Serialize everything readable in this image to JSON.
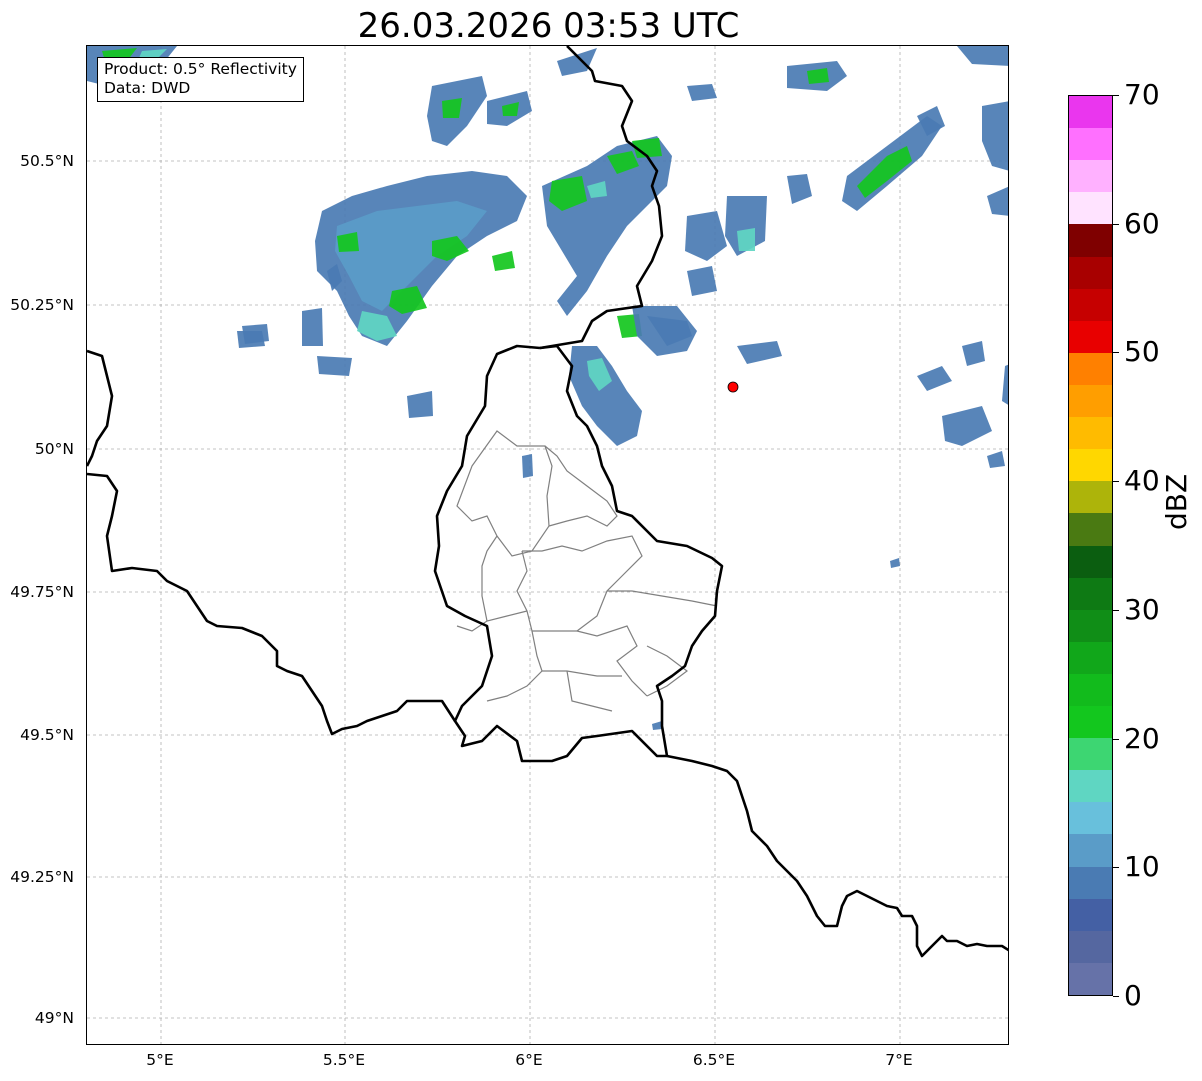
{
  "title": "26.03.2026 03:53 UTC",
  "info": {
    "product": "Product: 0.5° Reflectivity",
    "data_source": "Data: DWD"
  },
  "axes": {
    "lat_ticks": [
      "50.5°N",
      "50.25°N",
      "50°N",
      "49.75°N",
      "49.5°N",
      "49.25°N",
      "49°N"
    ],
    "lon_ticks": [
      "5°E",
      "5.5°E",
      "6°E",
      "6.5°E",
      "7°E"
    ]
  },
  "colorbar": {
    "label": "dBZ",
    "ticks": [
      "0",
      "10",
      "20",
      "30",
      "40",
      "50",
      "60",
      "70"
    ],
    "min": 0,
    "max": 70,
    "step": 2.5,
    "colors": [
      "#6672a8",
      "#5567a0",
      "#4460a4",
      "#4a7bb3",
      "#5a9cc8",
      "#68c0dc",
      "#5fd6c2",
      "#3dd672",
      "#13c71e",
      "#12bb1c",
      "#11a71a",
      "#108e17",
      "#0e7a14",
      "#0b5e10",
      "#4a7a12",
      "#adb40a",
      "#ffd700",
      "#ffbb00",
      "#ff9e00",
      "#ff8000",
      "#e80000",
      "#c60000",
      "#a80000",
      "#7f0000",
      "#ffe3ff",
      "#ffb1ff",
      "#ff70ff",
      "#ea36ee"
    ]
  },
  "marker": {
    "color": "#ff0000"
  },
  "colors": {
    "gridline": "#b0b0b0",
    "border": "#000000",
    "district": "#808080"
  }
}
